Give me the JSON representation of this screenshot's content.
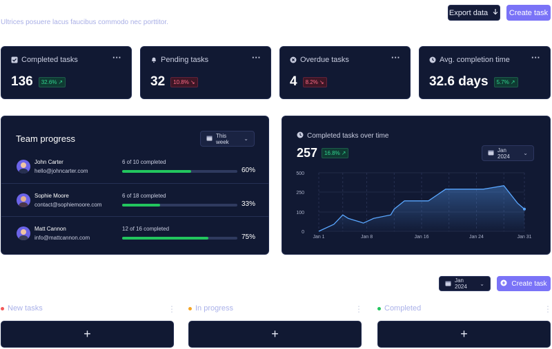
{
  "header": {
    "subtitle": "Ultrices posuere lacus faucibus commodo nec porttitor.",
    "export_label": "Export data",
    "create_label": "Create task"
  },
  "stats": [
    {
      "label": "Completed tasks",
      "value": "136",
      "change": "32.6%",
      "trend": "up",
      "icon": "check-square-icon"
    },
    {
      "label": "Pending tasks",
      "value": "32",
      "change": "10.8%",
      "trend": "down",
      "icon": "bell-icon"
    },
    {
      "label": "Overdue tasks",
      "value": "4",
      "change": "8.2%",
      "trend": "down",
      "icon": "x-circle-icon"
    },
    {
      "label": "Avg. completion time",
      "value": "32.6 days",
      "change": "5.7%",
      "trend": "up",
      "icon": "clock-icon"
    }
  ],
  "team": {
    "title": "Team progress",
    "range": "This week",
    "members": [
      {
        "name": "John Carter",
        "email": "hello@johncarter.com",
        "count": "6 of 10 completed",
        "pct": "60%",
        "progress": 0.6
      },
      {
        "name": "Sophie Moore",
        "email": "contact@sophiemoore.com",
        "count": "6 of 18 completed",
        "pct": "33%",
        "progress": 0.33
      },
      {
        "name": "Matt Cannon",
        "email": "info@mattcannon.com",
        "count": "12 of 16 completed",
        "pct": "75%",
        "progress": 0.75
      }
    ]
  },
  "overtime": {
    "title": "Completed tasks over time",
    "value": "257",
    "change": "16.8%",
    "range": "Jan 2024"
  },
  "chart_data": {
    "type": "area",
    "title": "Completed tasks over time",
    "xlabel": "",
    "ylabel": "",
    "x_ticks": [
      "Jan 1",
      "Jan 8",
      "Jan 16",
      "Jan 24",
      "Jan 31"
    ],
    "y_ticks": [
      "0",
      "100",
      "250",
      "500"
    ],
    "ylim": [
      0,
      500
    ],
    "x": [
      1,
      3.2,
      4.5,
      5.3,
      7,
      7.5,
      9,
      11.5,
      12,
      13.5,
      16,
      17,
      19.5,
      21,
      23,
      25,
      26,
      28,
      30,
      31
    ],
    "values": [
      0,
      60,
      140,
      110,
      80,
      70,
      110,
      140,
      190,
      260,
      260,
      260,
      360,
      360,
      360,
      360,
      370,
      390,
      240,
      190
    ],
    "grid": true,
    "accent": "#5aa7ff"
  },
  "board": {
    "range": "Jan 2024",
    "create_label": "Create task",
    "columns": [
      {
        "label": "New tasks",
        "color": "#f25858"
      },
      {
        "label": "In progress",
        "color": "#f5a524"
      },
      {
        "label": "Completed",
        "color": "#22c55e"
      }
    ],
    "add_symbol": "+"
  }
}
